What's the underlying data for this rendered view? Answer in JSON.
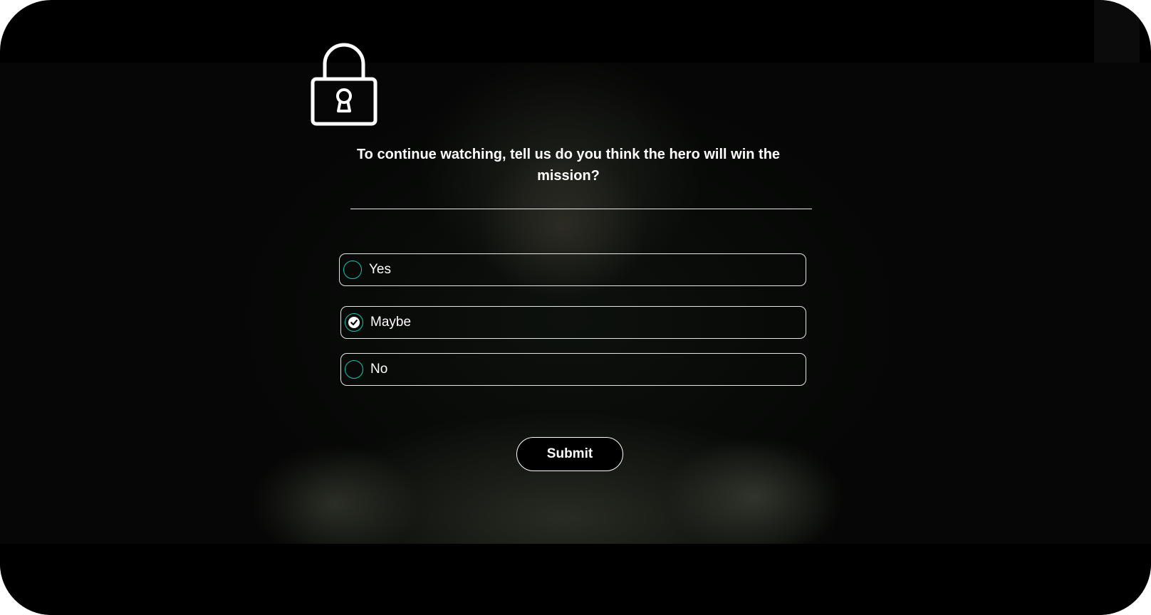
{
  "app": {
    "screen": "video-paywall-survey"
  },
  "video": {
    "background_color": "#050605"
  },
  "overlay": {
    "icon": "lock-icon",
    "question": "To continue watching, tell us do you think the hero will win the mission?",
    "options": [
      {
        "label": "Yes",
        "selected": false
      },
      {
        "label": "Maybe",
        "selected": true
      },
      {
        "label": "No",
        "selected": false
      }
    ],
    "submit_label": "Submit"
  },
  "colors": {
    "accent": "#19c2b3",
    "text": "#ffffff",
    "background": "#000000"
  }
}
